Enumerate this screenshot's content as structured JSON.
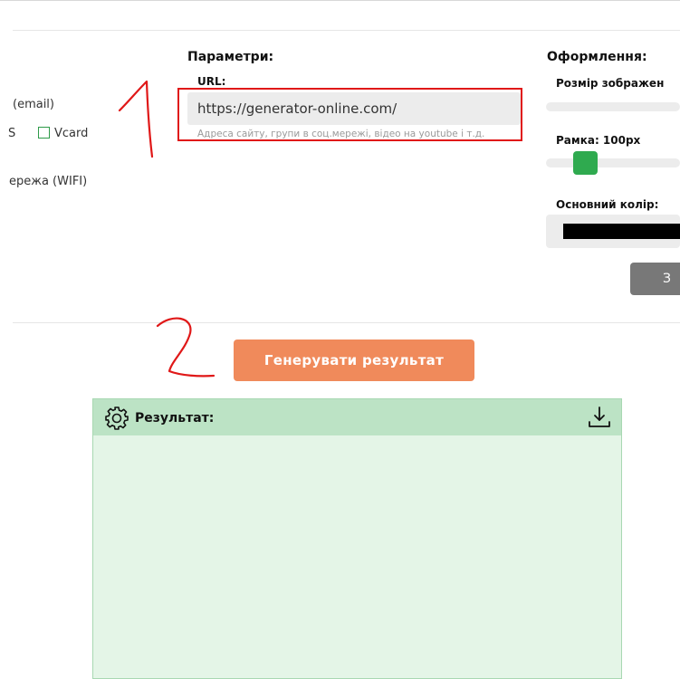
{
  "left_options": {
    "email": "(email)",
    "sms_fragment": "S",
    "vcard": "Vcard",
    "wifi": "ережа (WIFI)"
  },
  "params": {
    "title": "Параметри:",
    "url_label": "URL:",
    "url_value": "https://generator-online.com/",
    "url_hint": "Адреса сайту, групи в соц.мережі, відео на youtube і т.д."
  },
  "design": {
    "title": "Оформлення:",
    "size_label": "Розмір зображен",
    "frame_label": "Рамка: 100px",
    "color_label": "Основний колір:",
    "color_value": "#000000",
    "gray_button_label": "З"
  },
  "generate_button": "Генерувати результат",
  "result": {
    "title": "Результат:"
  },
  "annotations": {
    "mark1": "1",
    "mark2": "2",
    "color": "#e01818"
  }
}
